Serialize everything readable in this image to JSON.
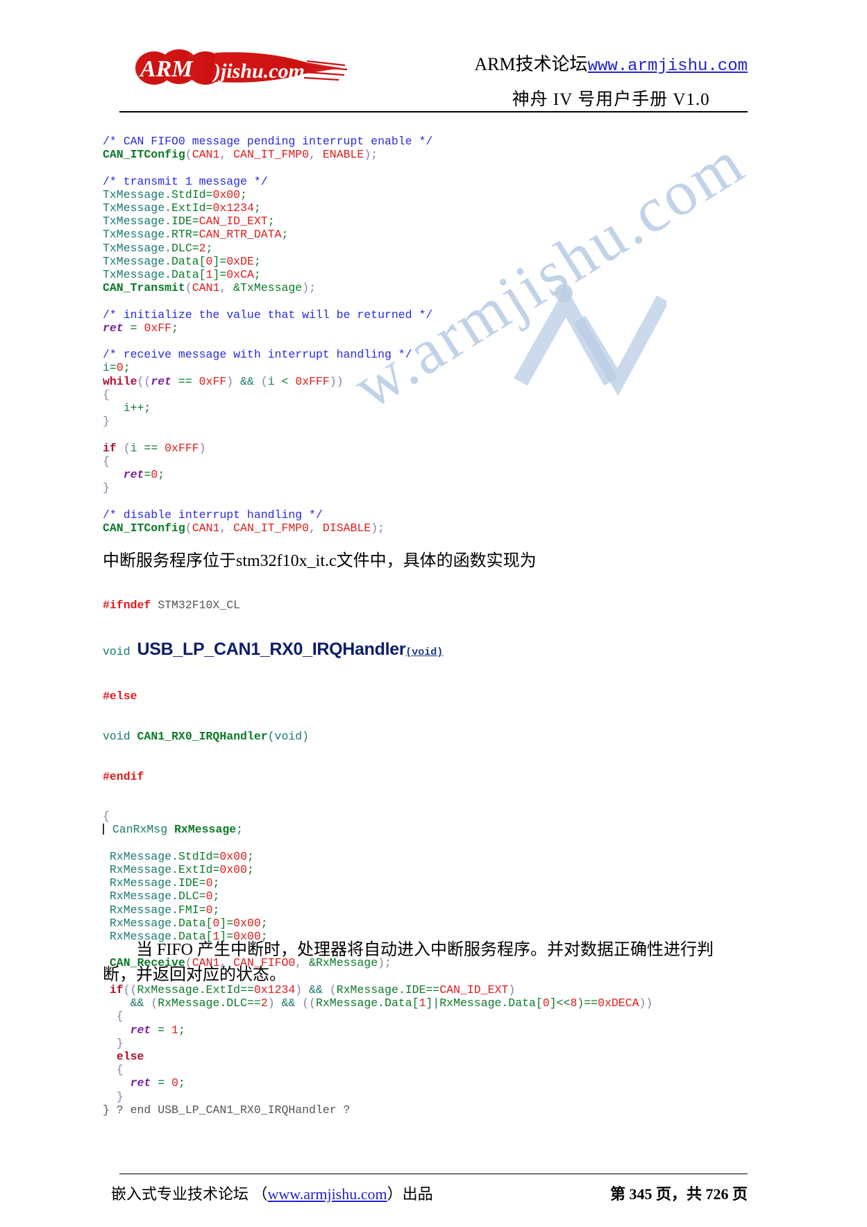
{
  "header": {
    "logo_alt": "ARMjishu.com",
    "logo_text_arm": "ARM",
    "logo_text_jishu": "jishu.com",
    "line1_prefix": "ARM技术论坛",
    "line1_link": "www.armjishu.com",
    "line2": "神舟 IV 号用户手册  V1.0"
  },
  "watermark": {
    "text": "w.armjishu.com"
  },
  "code_block_1": [
    [
      {
        "t": "/* CAN FIFO0 message pending interrupt enable */",
        "c": "cmt"
      }
    ],
    [
      {
        "t": "CAN_ITConfig",
        "c": "fn"
      },
      {
        "t": "(",
        "c": "brace"
      },
      {
        "t": "CAN1",
        "c": "num"
      },
      {
        "t": ", ",
        "c": "brace"
      },
      {
        "t": "CAN_IT_FMP0",
        "c": "num"
      },
      {
        "t": ", ",
        "c": "brace"
      },
      {
        "t": "ENABLE",
        "c": "num"
      },
      {
        "t": ");",
        "c": "brace"
      }
    ],
    [
      {
        "t": " ",
        "c": "plain"
      }
    ],
    [
      {
        "t": "/* transmit 1 message */",
        "c": "cmt"
      }
    ],
    [
      {
        "t": "TxMessage",
        "c": "id"
      },
      {
        "t": ".",
        "c": "id"
      },
      {
        "t": "StdId",
        "c": "mem"
      },
      {
        "t": "=",
        "c": "mem"
      },
      {
        "t": "0x00",
        "c": "num"
      },
      {
        "t": ";",
        "c": "mem"
      }
    ],
    [
      {
        "t": "TxMessage",
        "c": "id"
      },
      {
        "t": ".",
        "c": "id"
      },
      {
        "t": "ExtId",
        "c": "mem"
      },
      {
        "t": "=",
        "c": "mem"
      },
      {
        "t": "0x1234",
        "c": "num"
      },
      {
        "t": ";",
        "c": "mem"
      }
    ],
    [
      {
        "t": "TxMessage",
        "c": "id"
      },
      {
        "t": ".",
        "c": "id"
      },
      {
        "t": "IDE",
        "c": "mem"
      },
      {
        "t": "=",
        "c": "mem"
      },
      {
        "t": "CAN_ID_EXT",
        "c": "num"
      },
      {
        "t": ";",
        "c": "mem"
      }
    ],
    [
      {
        "t": "TxMessage",
        "c": "id"
      },
      {
        "t": ".",
        "c": "id"
      },
      {
        "t": "RTR",
        "c": "mem"
      },
      {
        "t": "=",
        "c": "mem"
      },
      {
        "t": "CAN_RTR_DATA",
        "c": "num"
      },
      {
        "t": ";",
        "c": "mem"
      }
    ],
    [
      {
        "t": "TxMessage",
        "c": "id"
      },
      {
        "t": ".",
        "c": "id"
      },
      {
        "t": "DLC",
        "c": "mem"
      },
      {
        "t": "=",
        "c": "mem"
      },
      {
        "t": "2",
        "c": "num"
      },
      {
        "t": ";",
        "c": "mem"
      }
    ],
    [
      {
        "t": "TxMessage",
        "c": "id"
      },
      {
        "t": ".",
        "c": "id"
      },
      {
        "t": "Data",
        "c": "mem"
      },
      {
        "t": "[",
        "c": "mem"
      },
      {
        "t": "0",
        "c": "num"
      },
      {
        "t": "]=",
        "c": "mem"
      },
      {
        "t": "0xDE",
        "c": "num"
      },
      {
        "t": ";",
        "c": "mem"
      }
    ],
    [
      {
        "t": "TxMessage",
        "c": "id"
      },
      {
        "t": ".",
        "c": "id"
      },
      {
        "t": "Data",
        "c": "mem"
      },
      {
        "t": "[",
        "c": "mem"
      },
      {
        "t": "1",
        "c": "num"
      },
      {
        "t": "]=",
        "c": "mem"
      },
      {
        "t": "0xCA",
        "c": "num"
      },
      {
        "t": ";",
        "c": "mem"
      }
    ],
    [
      {
        "t": "CAN_Transmit",
        "c": "fn"
      },
      {
        "t": "(",
        "c": "brace"
      },
      {
        "t": "CAN1",
        "c": "num"
      },
      {
        "t": ", ",
        "c": "brace"
      },
      {
        "t": "&TxMessage",
        "c": "mem"
      },
      {
        "t": ");",
        "c": "brace"
      }
    ],
    [
      {
        "t": " ",
        "c": "plain"
      }
    ],
    [
      {
        "t": "/* initialize the value that will be returned */",
        "c": "cmt"
      }
    ],
    [
      {
        "t": "ret",
        "c": "var"
      },
      {
        "t": " = ",
        "c": "mem"
      },
      {
        "t": "0xFF",
        "c": "num"
      },
      {
        "t": ";",
        "c": "mem"
      }
    ],
    [
      {
        "t": " ",
        "c": "plain"
      }
    ],
    [
      {
        "t": "/* receive message with interrupt handling */",
        "c": "cmt"
      }
    ],
    [
      {
        "t": "i",
        "c": "id"
      },
      {
        "t": "=",
        "c": "mem"
      },
      {
        "t": "0",
        "c": "num"
      },
      {
        "t": ";",
        "c": "mem"
      }
    ],
    [
      {
        "t": "while",
        "c": "kw"
      },
      {
        "t": "((",
        "c": "brace"
      },
      {
        "t": "ret",
        "c": "var"
      },
      {
        "t": " == ",
        "c": "mem"
      },
      {
        "t": "0xFF",
        "c": "num"
      },
      {
        "t": ") ",
        "c": "brace"
      },
      {
        "t": "&&",
        "c": "op"
      },
      {
        "t": " (",
        "c": "brace"
      },
      {
        "t": "i",
        "c": "id"
      },
      {
        "t": " < ",
        "c": "mem"
      },
      {
        "t": "0xFFF",
        "c": "num"
      },
      {
        "t": "))",
        "c": "brace"
      }
    ],
    [
      {
        "t": "{",
        "c": "brace"
      }
    ],
    [
      {
        "t": "   ",
        "c": "plain"
      },
      {
        "t": "i",
        "c": "id"
      },
      {
        "t": "++;",
        "c": "mem"
      }
    ],
    [
      {
        "t": "}",
        "c": "brace"
      }
    ],
    [
      {
        "t": " ",
        "c": "plain"
      }
    ],
    [
      {
        "t": "if",
        "c": "kw"
      },
      {
        "t": " (",
        "c": "brace"
      },
      {
        "t": "i",
        "c": "id"
      },
      {
        "t": " == ",
        "c": "mem"
      },
      {
        "t": "0xFFF",
        "c": "num"
      },
      {
        "t": ")",
        "c": "brace"
      }
    ],
    [
      {
        "t": "{",
        "c": "brace"
      }
    ],
    [
      {
        "t": "   ",
        "c": "plain"
      },
      {
        "t": "ret",
        "c": "var"
      },
      {
        "t": "=",
        "c": "mem"
      },
      {
        "t": "0",
        "c": "num"
      },
      {
        "t": ";",
        "c": "mem"
      }
    ],
    [
      {
        "t": "}",
        "c": "brace"
      }
    ],
    [
      {
        "t": " ",
        "c": "plain"
      }
    ],
    [
      {
        "t": "/* disable interrupt handling */",
        "c": "cmt"
      }
    ],
    [
      {
        "t": "CAN_ITConfig",
        "c": "fn"
      },
      {
        "t": "(",
        "c": "brace"
      },
      {
        "t": "CAN1",
        "c": "num"
      },
      {
        "t": ", ",
        "c": "brace"
      },
      {
        "t": "CAN_IT_FMP0",
        "c": "num"
      },
      {
        "t": ", ",
        "c": "brace"
      },
      {
        "t": "DISABLE",
        "c": "num"
      },
      {
        "t": ");",
        "c": "brace"
      }
    ]
  ],
  "paragraph_intro": "中断服务程序位于stm32f10x_it.c文件中，具体的函数实现为",
  "code_block_2": {
    "line_ifndef_kw": "#ifndef",
    "line_ifndef_arg": " STM32F10X_CL",
    "line_void": "void ",
    "big_function_name": "USB_LP_CAN1_RX0_IRQHandler",
    "big_function_args": "(void)",
    "line_else": "#else",
    "line_void2": "void ",
    "fn2_name": "CAN1_RX0_IRQHandler",
    "fn2_args": "(void)",
    "line_endif": "#endif",
    "rest": [
      [
        {
          "t": "{",
          "c": "brace"
        }
      ],
      [
        {
          "t": "BAR",
          "c": "bar"
        },
        {
          "t": " CanRxMsg ",
          "c": "id"
        },
        {
          "t": "RxMessage",
          "c": "fn"
        },
        {
          "t": ";",
          "c": "id"
        }
      ],
      [
        {
          "t": " ",
          "c": "plain"
        }
      ],
      [
        {
          "t": " RxMessage",
          "c": "id"
        },
        {
          "t": ".",
          "c": "id"
        },
        {
          "t": "StdId",
          "c": "mem"
        },
        {
          "t": "=",
          "c": "mem"
        },
        {
          "t": "0x00",
          "c": "num"
        },
        {
          "t": ";",
          "c": "mem"
        }
      ],
      [
        {
          "t": " RxMessage",
          "c": "id"
        },
        {
          "t": ".",
          "c": "id"
        },
        {
          "t": "ExtId",
          "c": "mem"
        },
        {
          "t": "=",
          "c": "mem"
        },
        {
          "t": "0x00",
          "c": "num"
        },
        {
          "t": ";",
          "c": "mem"
        }
      ],
      [
        {
          "t": " RxMessage",
          "c": "id"
        },
        {
          "t": ".",
          "c": "id"
        },
        {
          "t": "IDE",
          "c": "mem"
        },
        {
          "t": "=",
          "c": "mem"
        },
        {
          "t": "0",
          "c": "num"
        },
        {
          "t": ";",
          "c": "mem"
        }
      ],
      [
        {
          "t": " RxMessage",
          "c": "id"
        },
        {
          "t": ".",
          "c": "id"
        },
        {
          "t": "DLC",
          "c": "mem"
        },
        {
          "t": "=",
          "c": "mem"
        },
        {
          "t": "0",
          "c": "num"
        },
        {
          "t": ";",
          "c": "mem"
        }
      ],
      [
        {
          "t": " RxMessage",
          "c": "id"
        },
        {
          "t": ".",
          "c": "id"
        },
        {
          "t": "FMI",
          "c": "mem"
        },
        {
          "t": "=",
          "c": "mem"
        },
        {
          "t": "0",
          "c": "num"
        },
        {
          "t": ";",
          "c": "mem"
        }
      ],
      [
        {
          "t": " RxMessage",
          "c": "id"
        },
        {
          "t": ".",
          "c": "id"
        },
        {
          "t": "Data",
          "c": "mem"
        },
        {
          "t": "[",
          "c": "mem"
        },
        {
          "t": "0",
          "c": "num"
        },
        {
          "t": "]=",
          "c": "mem"
        },
        {
          "t": "0x00",
          "c": "num"
        },
        {
          "t": ";",
          "c": "mem"
        }
      ],
      [
        {
          "t": " RxMessage",
          "c": "id"
        },
        {
          "t": ".",
          "c": "id"
        },
        {
          "t": "Data",
          "c": "mem"
        },
        {
          "t": "[",
          "c": "mem"
        },
        {
          "t": "1",
          "c": "num"
        },
        {
          "t": "]=",
          "c": "mem"
        },
        {
          "t": "0x00",
          "c": "num"
        },
        {
          "t": ";",
          "c": "mem"
        }
      ],
      [
        {
          "t": " ",
          "c": "plain"
        }
      ],
      [
        {
          "t": " ",
          "c": "plain"
        },
        {
          "t": "CAN_Receive",
          "c": "fn"
        },
        {
          "t": "(",
          "c": "brace"
        },
        {
          "t": "CAN1",
          "c": "num"
        },
        {
          "t": ", ",
          "c": "brace"
        },
        {
          "t": "CAN_FIFO0",
          "c": "num"
        },
        {
          "t": ", ",
          "c": "brace"
        },
        {
          "t": "&RxMessage",
          "c": "mem"
        },
        {
          "t": ");",
          "c": "brace"
        }
      ],
      [
        {
          "t": " ",
          "c": "plain"
        }
      ],
      [
        {
          "t": " ",
          "c": "plain"
        },
        {
          "t": "if",
          "c": "kw"
        },
        {
          "t": "((",
          "c": "brace"
        },
        {
          "t": "RxMessage.ExtId",
          "c": "mem"
        },
        {
          "t": "==",
          "c": "mem"
        },
        {
          "t": "0x1234",
          "c": "num"
        },
        {
          "t": ") ",
          "c": "brace"
        },
        {
          "t": "&&",
          "c": "op"
        },
        {
          "t": " (",
          "c": "brace"
        },
        {
          "t": "RxMessage.IDE",
          "c": "mem"
        },
        {
          "t": "==",
          "c": "mem"
        },
        {
          "t": "CAN_ID_EXT",
          "c": "num"
        },
        {
          "t": ")",
          "c": "brace"
        }
      ],
      [
        {
          "t": "    ",
          "c": "plain"
        },
        {
          "t": "&&",
          "c": "op"
        },
        {
          "t": " (",
          "c": "brace"
        },
        {
          "t": "RxMessage.DLC",
          "c": "mem"
        },
        {
          "t": "==",
          "c": "mem"
        },
        {
          "t": "2",
          "c": "num"
        },
        {
          "t": ") ",
          "c": "brace"
        },
        {
          "t": "&&",
          "c": "op"
        },
        {
          "t": " ((",
          "c": "brace"
        },
        {
          "t": "RxMessage.Data",
          "c": "mem"
        },
        {
          "t": "[",
          "c": "mem"
        },
        {
          "t": "1",
          "c": "num"
        },
        {
          "t": "]|",
          "c": "mem"
        },
        {
          "t": "RxMessage.Data",
          "c": "mem"
        },
        {
          "t": "[",
          "c": "mem"
        },
        {
          "t": "0",
          "c": "num"
        },
        {
          "t": "]<<",
          "c": "mem"
        },
        {
          "t": "8",
          "c": "num"
        },
        {
          "t": ")==",
          "c": "mem"
        },
        {
          "t": "0xDECA",
          "c": "num"
        },
        {
          "t": "))",
          "c": "brace"
        }
      ],
      [
        {
          "t": "  {",
          "c": "brace"
        }
      ],
      [
        {
          "t": "    ",
          "c": "plain"
        },
        {
          "t": "ret",
          "c": "var"
        },
        {
          "t": " = ",
          "c": "mem"
        },
        {
          "t": "1",
          "c": "num"
        },
        {
          "t": ";",
          "c": "mem"
        }
      ],
      [
        {
          "t": "  }",
          "c": "brace"
        }
      ],
      [
        {
          "t": "  ",
          "c": "plain"
        },
        {
          "t": "else",
          "c": "kw"
        }
      ],
      [
        {
          "t": "  {",
          "c": "brace"
        }
      ],
      [
        {
          "t": "    ",
          "c": "plain"
        },
        {
          "t": "ret",
          "c": "var"
        },
        {
          "t": " = ",
          "c": "mem"
        },
        {
          "t": "0",
          "c": "num"
        },
        {
          "t": ";",
          "c": "mem"
        }
      ],
      [
        {
          "t": "  }",
          "c": "brace"
        }
      ],
      [
        {
          "t": "} ? end USB_LP_CAN1_RX0_IRQHandler ?",
          "c": "gray"
        }
      ]
    ]
  },
  "paragraph_outro": "当 FIFO 产生中断时，处理器将自动进入中断服务程序。并对数据正确性进行判断，并返回对应的状态。",
  "footer": {
    "left_prefix": "嵌入式专业技术论坛  （",
    "left_link": "www.armjishu.com",
    "left_suffix": "）出品",
    "page_info": "第 345 页，共 726 页"
  }
}
